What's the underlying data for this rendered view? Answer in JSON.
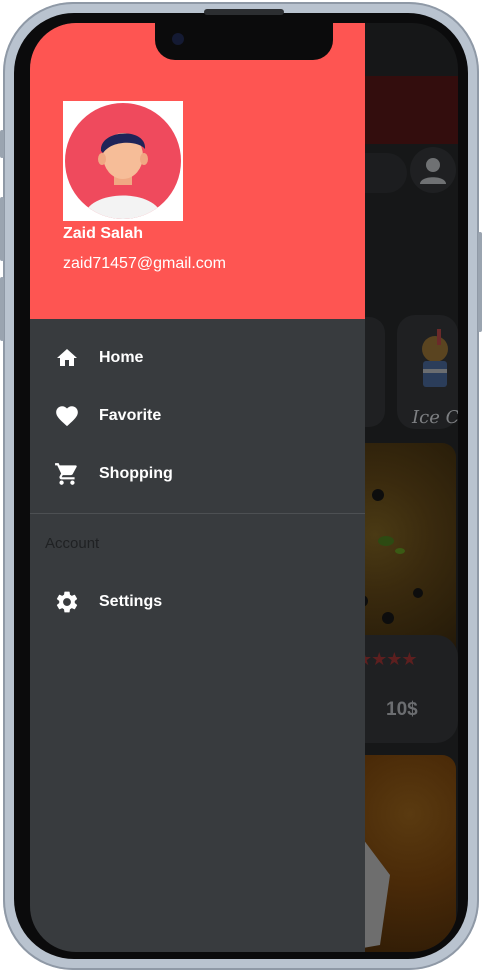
{
  "user": {
    "name": "Zaid Salah",
    "email": "zaid71457@gmail.com"
  },
  "menu": {
    "items": [
      {
        "label": "Home",
        "icon": "home-icon"
      },
      {
        "label": "Favorite",
        "icon": "heart-icon"
      },
      {
        "label": "Shopping",
        "icon": "cart-icon"
      }
    ],
    "section_label": "Account",
    "settings": {
      "label": "Settings",
      "icon": "gear-icon"
    }
  },
  "background_app": {
    "category_label": "Ice Cr",
    "price": "10$",
    "rating_stars": "★★★★"
  },
  "colors": {
    "header": "#fe5552",
    "drawer": "#383b3e",
    "scrim": "#161718"
  }
}
